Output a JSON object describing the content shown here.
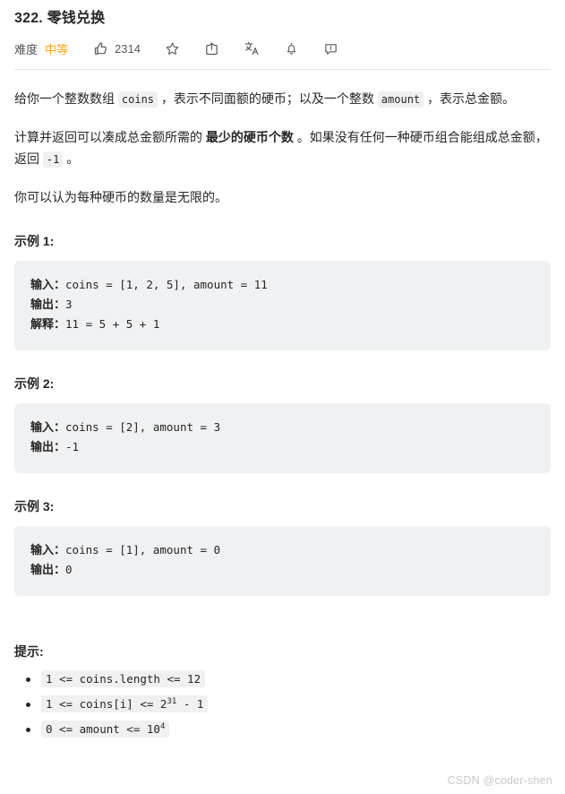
{
  "header": {
    "title": "322. 零钱兑换",
    "difficulty_label": "难度",
    "difficulty_value": "中等",
    "difficulty_color": "#ffa116",
    "like_count": "2314",
    "icons": [
      {
        "name": "thumbs-up-icon",
        "label": "点赞"
      },
      {
        "name": "star-icon",
        "label": "收藏"
      },
      {
        "name": "share-icon",
        "label": "分享"
      },
      {
        "name": "translate-icon",
        "label": "切换语言"
      },
      {
        "name": "bell-icon",
        "label": "订阅"
      },
      {
        "name": "report-icon",
        "label": "反馈"
      }
    ]
  },
  "description": {
    "p1_a": "给你一个整数数组 ",
    "p1_code1": "coins",
    "p1_b": " ，表示不同面额的硬币；以及一个整数 ",
    "p1_code2": "amount",
    "p1_c": " ，表示总金额。",
    "p2_a": "计算并返回可以凑成总金额所需的 ",
    "p2_bold": "最少的硬币个数",
    "p2_b": " 。如果没有任何一种硬币组合能组成总金额，返回 ",
    "p2_code": "-1",
    "p2_c": " 。",
    "p3": "你可以认为每种硬币的数量是无限的。"
  },
  "examples": [
    {
      "heading": "示例 1:",
      "input_label": "输入：",
      "input_value": "coins = [1, 2, 5], amount = 11",
      "output_label": "输出：",
      "output_value": "3",
      "explain_label": "解释：",
      "explain_value": "11 = 5 + 5 + 1"
    },
    {
      "heading": "示例 2:",
      "input_label": "输入：",
      "input_value": "coins = [2], amount = 3",
      "output_label": "输出：",
      "output_value": "-1",
      "explain_label": "",
      "explain_value": ""
    },
    {
      "heading": "示例 3:",
      "input_label": "输入：",
      "input_value": "coins = [1], amount = 0",
      "output_label": "输出：",
      "output_value": "0",
      "explain_label": "",
      "explain_value": ""
    }
  ],
  "hints": {
    "heading": "提示:",
    "items": [
      {
        "prefix": "1 <= coins.length <= 12",
        "sup": "",
        "suffix": ""
      },
      {
        "prefix": "1 <= coins[i] <= 2",
        "sup": "31",
        "suffix": " - 1"
      },
      {
        "prefix": "0 <= amount <= 10",
        "sup": "4",
        "suffix": ""
      }
    ]
  },
  "watermark": "CSDN @coder-shen"
}
